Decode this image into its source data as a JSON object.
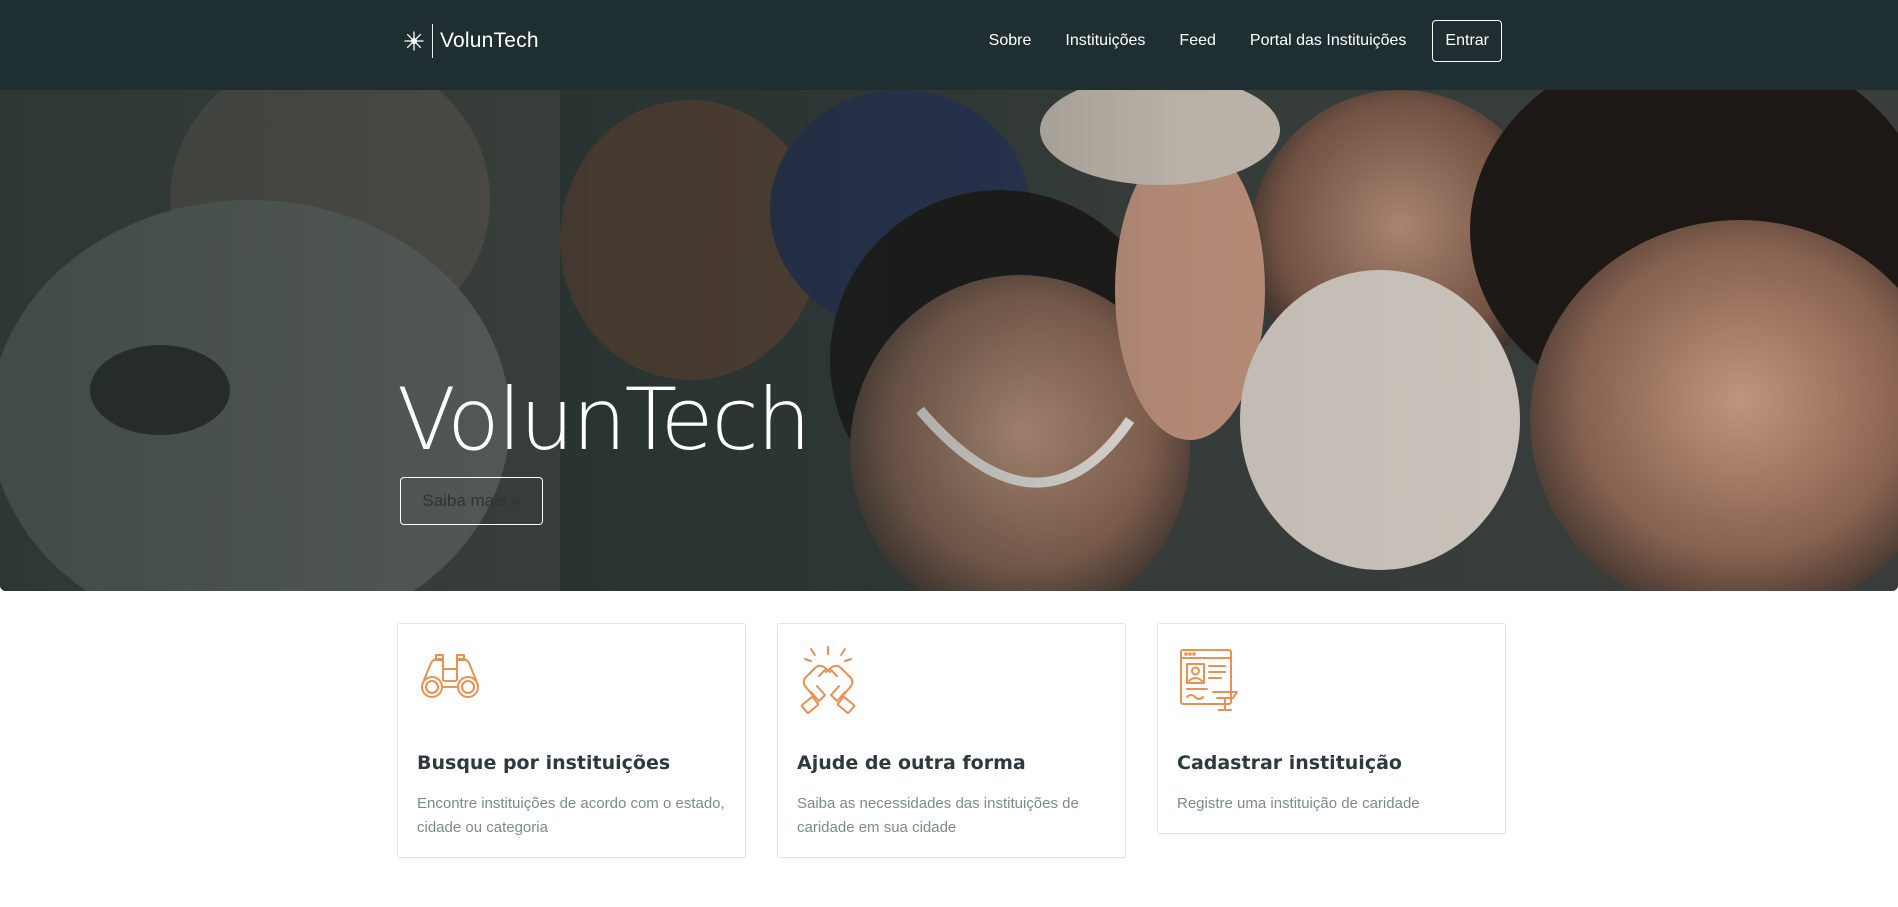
{
  "navbar": {
    "brand": "VolunTech",
    "links": [
      "Sobre",
      "Instituições",
      "Feed",
      "Portal das Instituições"
    ],
    "login_label": "Entrar"
  },
  "hero": {
    "title": "VolunTech",
    "button_label": "Saiba mais »"
  },
  "cards": [
    {
      "icon": "binoculars-icon",
      "title": "Busque por instituições",
      "text": "Encontre instituições de acordo com o estado, cidade ou categoria"
    },
    {
      "icon": "high-five-icon",
      "title": "Ajude de outra forma",
      "text": "Saiba as necessidades das instituições de caridade em sua cidade"
    },
    {
      "icon": "registration-form-icon",
      "title": "Cadastrar instituição",
      "text": "Registre uma instituição de caridade"
    }
  ],
  "colors": {
    "navbar_bg": "#1f2e31",
    "icon_accent": "#e89153",
    "card_title": "#2d3a3d",
    "card_text": "#7d8a8c"
  }
}
